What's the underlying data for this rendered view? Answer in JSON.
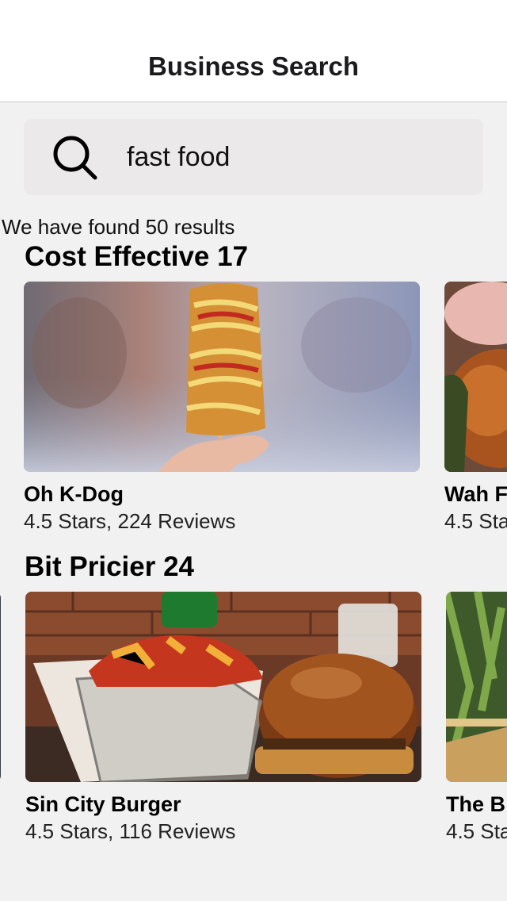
{
  "header": {
    "title": "Business Search"
  },
  "search": {
    "value": "fast food"
  },
  "results_summary": "We have found 50 results",
  "sections": [
    {
      "title": "Cost Effective 17",
      "cards": [
        {
          "name": "Oh K-Dog",
          "meta": "4.5 Stars, 224 Reviews"
        },
        {
          "name": "Wah F",
          "meta": "4.5 Sta"
        }
      ]
    },
    {
      "title": "Bit Pricier 24",
      "cards": [
        {
          "name": "Sin City Burger",
          "meta": "4.5 Stars, 116 Reviews"
        },
        {
          "name": "The B",
          "meta": "4.5 Sta"
        }
      ]
    }
  ],
  "colors": {
    "header_bg": "#ffffff",
    "page_bg": "#f2f1f2",
    "search_bg": "#ece9eb"
  },
  "icons": {
    "search": "search-icon"
  }
}
